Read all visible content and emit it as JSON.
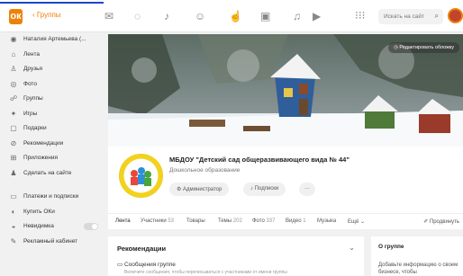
{
  "topbar": {
    "logo": "ок",
    "groups_link": "‹ Группы",
    "search_placeholder": "Искать на сайт",
    "icons": [
      "message-icon",
      "discussion-icon",
      "notification-icon",
      "guests-icon",
      "like-icon",
      "gift-icon",
      "music-icon",
      "video-icon"
    ]
  },
  "sidebar": {
    "items": [
      {
        "icon": "user-icon",
        "label": "Наталия Артемьева (..."
      },
      {
        "icon": "feed-icon",
        "label": "Лента"
      },
      {
        "icon": "friends-icon",
        "label": "Друзья"
      },
      {
        "icon": "photo-icon",
        "label": "Фото"
      },
      {
        "icon": "groups-icon",
        "label": "Группы"
      },
      {
        "icon": "games-icon",
        "label": "Игры"
      },
      {
        "icon": "gift-icon",
        "label": "Подарки"
      },
      {
        "icon": "recommendations-icon",
        "label": "Рекомендации"
      },
      {
        "icon": "apps-icon",
        "label": "Приложения"
      },
      {
        "icon": "ads-icon",
        "label": "Сделать на сайте"
      }
    ],
    "items2": [
      {
        "icon": "payments-icon",
        "label": "Платежи и подписки"
      },
      {
        "icon": "coins-icon",
        "label": "Купить ОКи"
      },
      {
        "icon": "invisible-icon",
        "label": "Невидимка"
      },
      {
        "icon": "ad-cabinet-icon",
        "label": "Рекламный кабинет"
      }
    ]
  },
  "cover": {
    "edit_label": "Редактировать обложку"
  },
  "group": {
    "title": "МБДОУ \"Детский сад общеразвивающего вида № 44\"",
    "category": "Дошкольное образование",
    "admin_button": "Администратор",
    "subscriptions_button": "Подписки",
    "more_button": "···"
  },
  "tabs": [
    {
      "label": "Лента",
      "count": ""
    },
    {
      "label": "Участники",
      "count": "53"
    },
    {
      "label": "Товары",
      "count": ""
    },
    {
      "label": "Темы",
      "count": "202"
    },
    {
      "label": "Фото",
      "count": "337"
    },
    {
      "label": "Видео",
      "count": "1"
    },
    {
      "label": "Музыка",
      "count": ""
    },
    {
      "label": "Ещё",
      "count": ""
    }
  ],
  "promote": "Продвинуть",
  "recommendations": {
    "title": "Рекомендации",
    "item": "Сообщения группе",
    "sub": "Включите сообщения, чтобы переписываться с участниками от имени группы"
  },
  "about": {
    "title": "О группе",
    "text": "Добавьте информацию о своем бизнесе, чтобы"
  },
  "colors": {
    "accent": "#ee8208",
    "link_blue": "#1a47c9"
  }
}
